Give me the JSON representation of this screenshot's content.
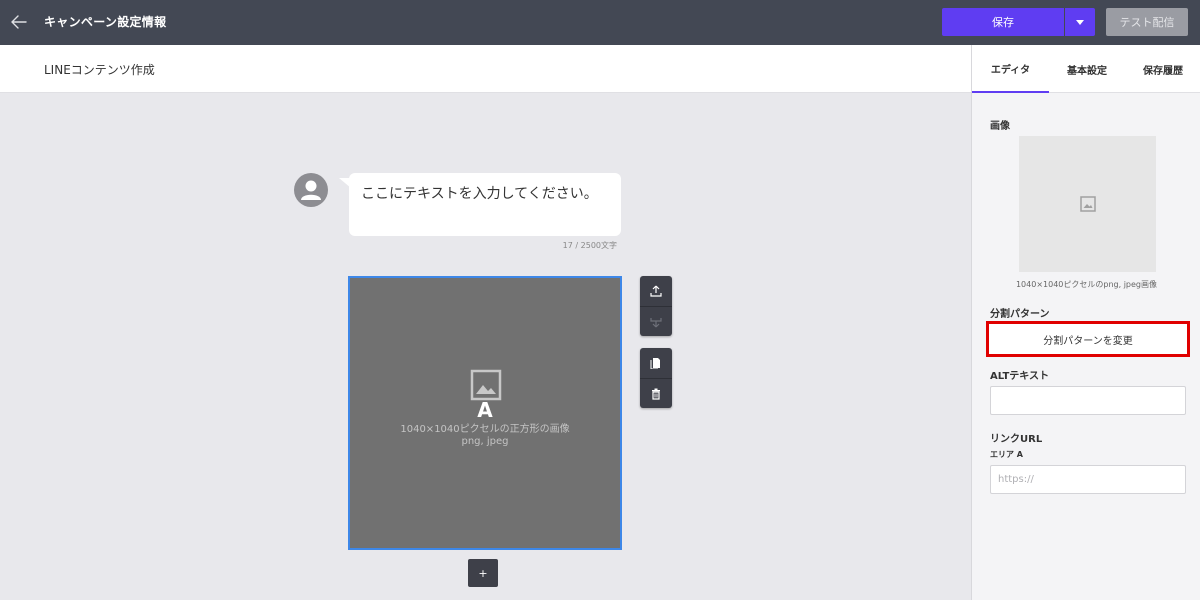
{
  "header": {
    "title": "キャンペーン設定情報",
    "save_label": "保存",
    "test_send_label": "テスト配信",
    "accent_color": "#5f3df2"
  },
  "subheader": {
    "title": "LINEコンテンツ作成"
  },
  "message": {
    "text": "ここにテキストを入力してください。",
    "char_count": "17 / 2500文字"
  },
  "image_block": {
    "area_label": "A",
    "caption_line1": "1040×1040ピクセルの正方形の画像",
    "caption_line2": "png, jpeg",
    "add_label": "+"
  },
  "panel": {
    "tabs": [
      {
        "label": "エディタ",
        "active": true
      },
      {
        "label": "基本設定",
        "active": false
      },
      {
        "label": "保存履歴",
        "active": false
      }
    ],
    "image_label": "画像",
    "image_caption": "1040×1040ピクセルのpng, jpeg画像",
    "split_pattern_label": "分割パターン",
    "change_pattern_button": "分割パターンを変更",
    "alt_text_label": "ALTテキスト",
    "alt_text_value": "",
    "link_url_label": "リンクURL",
    "area_a_label": "エリア A",
    "url_placeholder": "https://",
    "highlight_color": "#e00000"
  }
}
